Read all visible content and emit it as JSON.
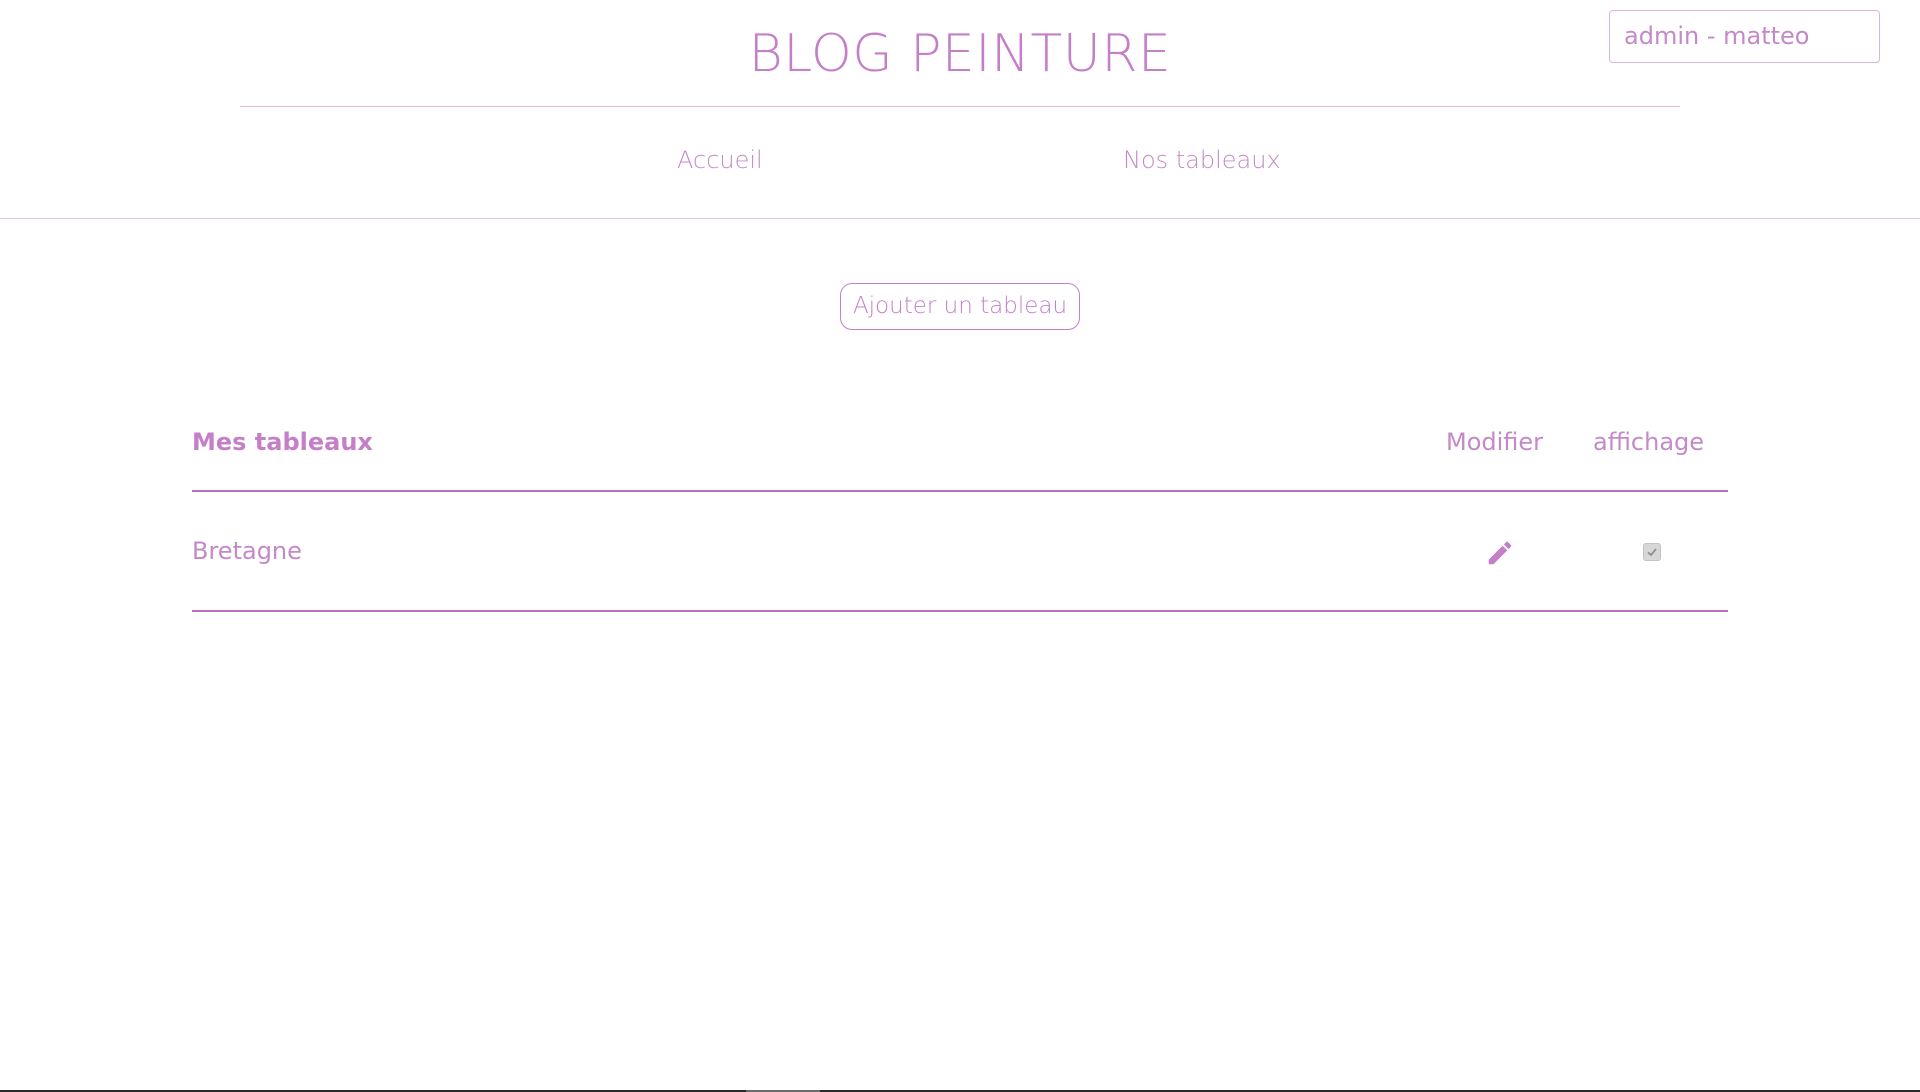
{
  "header": {
    "title": "BLOG PEINTURE",
    "user_label": "admin - matteo"
  },
  "nav": {
    "items": [
      {
        "label": "Accueil"
      },
      {
        "label": "Nos tableaux"
      }
    ]
  },
  "actions": {
    "add_label": "Ajouter un tableau"
  },
  "table": {
    "headers": {
      "title": "Mes tableaux",
      "modifier": "Modifier",
      "affichage": "affichage"
    },
    "rows": [
      {
        "name": "Bretagne",
        "edit_icon": "pencil-icon",
        "displayed": true
      }
    ]
  },
  "colors": {
    "accent": "#c47fc8",
    "rule": "#b86fbd",
    "checkbox_disabled": "#d7d7d7"
  }
}
